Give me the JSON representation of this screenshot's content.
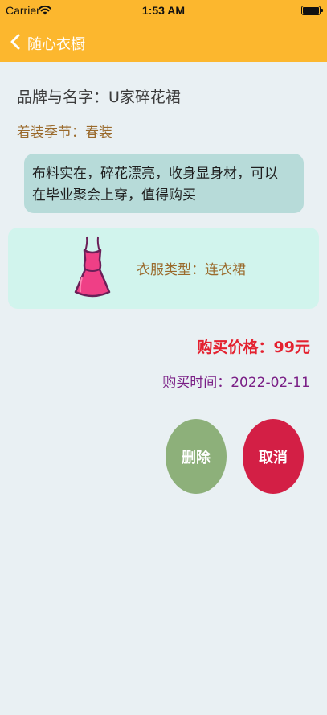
{
  "status_bar": {
    "carrier": "Carrier",
    "time": "1:53 AM"
  },
  "nav": {
    "back_icon": "chevron-left-icon",
    "title": "随心衣橱"
  },
  "item": {
    "brand": "品牌与名字：U家碎花裙",
    "season": "着装季节：春装",
    "description_line1": "布料实在，碎花漂亮，收身显身材，可以",
    "description_line2": "在毕业聚会上穿，值得购买",
    "type": "衣服类型：连衣裙",
    "type_icon": "dress-icon",
    "price": "购买价格：99元",
    "purchase_time": "购买时间：2022-02-11"
  },
  "actions": {
    "delete_label": "删除",
    "cancel_label": "取消"
  },
  "colors": {
    "header": "#fcb72e",
    "background": "#e9f0f3",
    "desc_box": "#b7dbd9",
    "type_card": "#d1f4ed",
    "price": "#e4212f",
    "time": "#7a1f86",
    "delete_button": "#8db07a",
    "cancel_button": "#d31f45"
  }
}
